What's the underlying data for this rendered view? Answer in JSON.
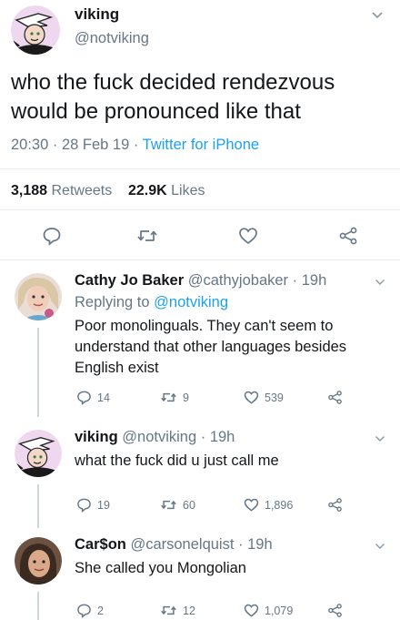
{
  "main_tweet": {
    "display_name": "viking",
    "handle": "@notviking",
    "text": "who the fuck decided rendezvous would be pronounced like that",
    "time": "20:30",
    "date": "28 Feb 19",
    "source": "Twitter for iPhone",
    "retweets_count": "3,188",
    "retweets_label": "Retweets",
    "likes_count": "22.9K",
    "likes_label": "Likes"
  },
  "replies": [
    {
      "display_name": "Cathy Jo Baker",
      "handle": "@cathyjobaker",
      "age": "19h",
      "replying_prefix": "Replying to",
      "replying_to": "@notviking",
      "text": "Poor monolinguals. They can't seem to understand that other languages besides English exist",
      "reply_count": "14",
      "retweet_count": "9",
      "like_count": "539"
    },
    {
      "display_name": "viking",
      "handle": "@notviking",
      "age": "19h",
      "text": "what the fuck did u just call me",
      "reply_count": "19",
      "retweet_count": "60",
      "like_count": "1,896"
    },
    {
      "display_name": "Car$on",
      "handle": "@carsonelquist",
      "age": "19h",
      "text": "She called you Mongolian",
      "reply_count": "2",
      "retweet_count": "12",
      "like_count": "1,079"
    }
  ],
  "separator": " · ",
  "icons": {
    "reply": "reply-icon",
    "retweet": "retweet-icon",
    "like": "heart-icon",
    "share": "share-icon",
    "menu": "chevron-down-icon"
  },
  "colors": {
    "link": "#1da1f2",
    "secondary_text": "#657786",
    "primary_text": "#14171a",
    "divider": "#e6ecf0"
  }
}
